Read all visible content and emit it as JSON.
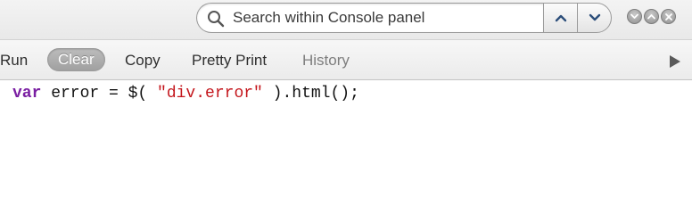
{
  "search": {
    "placeholder": "Search within Console panel",
    "value": ""
  },
  "toolbar": {
    "run_label": "Run",
    "clear_label": "Clear",
    "copy_label": "Copy",
    "pretty_print_label": "Pretty Print",
    "history_label": "History"
  },
  "code": {
    "keyword": "var",
    "middle": " error = $( ",
    "string": "\"div.error\"",
    "end": " ).html();"
  },
  "icons": {
    "search": "search-icon",
    "prev": "chevron-up-icon",
    "next": "chevron-down-icon",
    "minimize": "chevron-down-icon",
    "maximize": "chevron-up-icon",
    "close": "close-icon",
    "run": "play-icon"
  },
  "colors": {
    "keyword": "#7a1fa2",
    "string": "#c4161c",
    "clear_button": "#a8a8a8",
    "history_disabled": "#7e7e7e"
  }
}
